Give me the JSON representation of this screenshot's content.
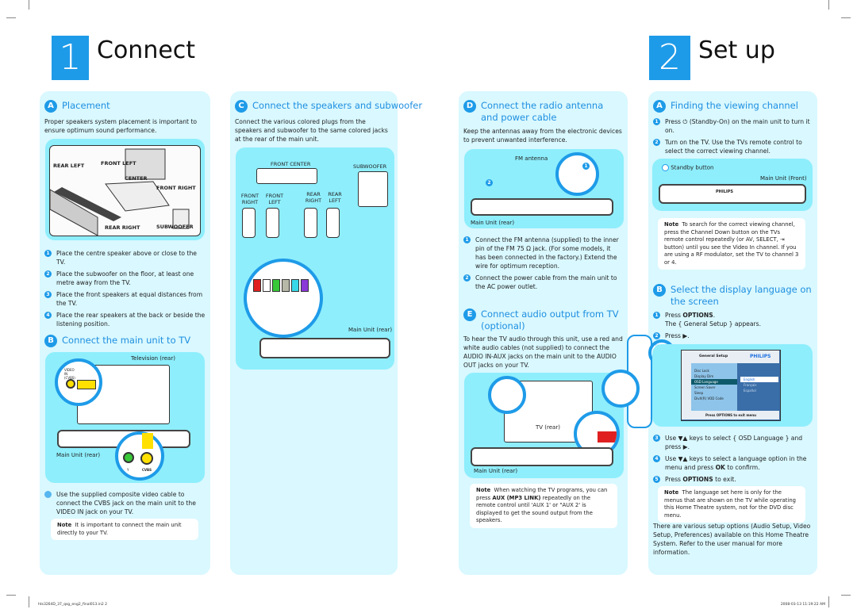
{
  "page": {
    "left_number": "1",
    "left_title": "Connect",
    "right_number": "2",
    "right_title": "Set up"
  },
  "colors": {
    "accent": "#1e9be8",
    "panel": "#d9f8ff",
    "diagram": "#8eeefc"
  },
  "placement": {
    "badge": "A",
    "title": "Placement",
    "intro": "Proper speakers system placement is important to ensure optimum sound performance.",
    "labels": [
      "REAR LEFT",
      "FRONT LEFT",
      "CENTER",
      "FRONT RIGHT",
      "REAR RIGHT",
      "SUBWOOFER"
    ],
    "steps": [
      "Place the centre speaker above or close to the TV.",
      "Place the subwoofer on the floor, at least one metre away from the TV.",
      "Place the front speakers at equal distances from the TV.",
      "Place the rear speakers at the back or beside the listening position."
    ]
  },
  "main_tv": {
    "badge": "B",
    "title": "Connect the main unit to TV",
    "tv_label": "Television (rear)",
    "unit_label": "Main Unit (rear)",
    "jack_video": "VIDEO IN (CVBS)",
    "jack_y": "Y",
    "jack_cvbs": "CVBS",
    "step": "Use the supplied composite video cable to connect the CVBS jack on the main unit to the VIDEO IN jack on your TV.",
    "note_label": "Note",
    "note": "It is important to connect the main unit directly to your TV."
  },
  "speakers": {
    "badge": "C",
    "title": "Connect the speakers and subwoofer",
    "intro": "Connect the various colored plugs from the speakers and subwoofer to the same colored jacks at the rear of the main unit.",
    "front_center": "FRONT CENTER",
    "subwoofer": "SUBWOOFER",
    "front_right": "FRONT RIGHT",
    "front_left": "FRONT LEFT",
    "rear_right": "REAR RIGHT",
    "rear_left": "REAR LEFT",
    "unit_label": "Main Unit (rear)",
    "plug_colors": [
      "#e02020",
      "#ffffff",
      "#38c838",
      "#b8b8a8",
      "#38d8e8",
      "#8a38d8"
    ]
  },
  "antenna": {
    "badge": "D",
    "title": "Connect the radio antenna and power cable",
    "intro": "Keep the antennas away from the electronic devices to prevent unwanted interference.",
    "fm_label": "FM antenna",
    "unit_label": "Main Unit (rear)",
    "steps": [
      "Connect the FM antenna (supplied) to the inner pin of the FM 75 Ω jack. (For some models, it has been connected in the factory.) Extend the wire for optimum reception.",
      "Connect the power cable from the main unit to the AC power outlet."
    ]
  },
  "audio": {
    "badge": "E",
    "title": "Connect audio output from TV (optional)",
    "intro": "To hear the TV audio through this unit, use a red and white audio cables (not supplied) to connect the AUDIO IN-AUX jacks on the main unit to the AUDIO OUT jacks on your TV.",
    "tv_label": "TV (rear)",
    "unit_label": "Main Unit (rear)",
    "note_label": "Note",
    "note_pre": "When watching the TV programs, you can press ",
    "note_bold": "AUX (MP3 LINK)",
    "note_post": " repeatedly on the remote control until 'AUX 1' or \"AUX 2' is displayed to get the sound output from the speakers."
  },
  "channel": {
    "badge": "A",
    "title": "Finding the viewing channel",
    "steps": [
      "Press ⏻ (Standby-On) on the main unit to turn it on.",
      "Turn on the TV. Use the TVs remote control to select the correct viewing channel."
    ],
    "standby_label": "Standby button",
    "front_label": "Main Unit (Front)",
    "brand": "PHILIPS",
    "note_label": "Note",
    "note": "To search for the correct viewing channel, press the Channel Down button on the TVs remote control repeatedly (or AV, SELECT, ⇥ button) until you see the Video In channel. If you are using a RF modulator, set the TV to channel 3 or 4."
  },
  "language": {
    "badge": "B",
    "title": "Select the display language on the screen",
    "step1_pre": "Press ",
    "step1_bold": "OPTIONS",
    "step1_post": ".",
    "step1_sub": "The { General Setup } appears.",
    "step2": "Press ▶.",
    "menu": {
      "title": "General Setup",
      "brand": "PHILIPS",
      "items": [
        "Disc Lock",
        "Display Dim",
        "OSD Language",
        "Screen Saver",
        "Sleep",
        "DivX(R) VOD Code"
      ],
      "selected": "OSD Language",
      "options": [
        "English",
        "Français",
        "Español"
      ],
      "selected_option": "English",
      "footer": "Press OPTIONS to exit menu"
    },
    "remote_label": "OPTIONS",
    "step3": "Use ▼▲ keys to select { OSD Language } and press ▶.",
    "step4_pre": "Use ▼▲ keys to select a language option in the menu and press ",
    "step4_bold": "OK",
    "step4_post": " to confirm.",
    "step5_pre": "Press ",
    "step5_bold": "OPTIONS",
    "step5_post": " to exit.",
    "note_label": "Note",
    "note": "The language set here is only for the menus that are shown on the TV while operating this Home Theatre system, not for the DVD disc menu.",
    "footer": "There are various setup options (Audio Setup, Video Setup, Preferences) available on this Home Theatre System. Refer to the user manual for more information."
  },
  "footer": {
    "file": "hts3264D_37_qsg_eng2_final013.in2   2",
    "date": "2008-03-13   11:19:22 AM"
  }
}
